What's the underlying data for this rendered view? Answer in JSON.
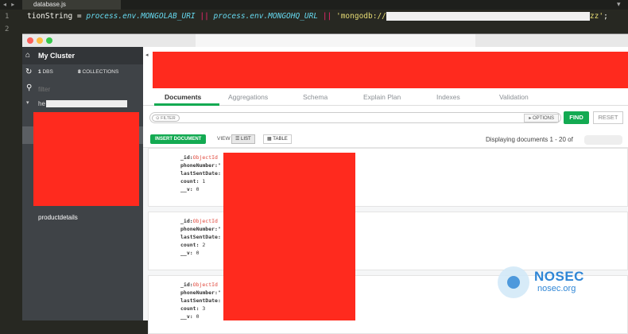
{
  "editor": {
    "tab_label": "database.js",
    "nav_arrows": "◂ ▸",
    "close_glyph": "▾",
    "line_numbers": [
      "1",
      "2"
    ],
    "code": {
      "part1": "tionString = ",
      "obj1": "process.env.MONGOLAB_URI",
      "op1": " || ",
      "obj2": "process.env.MONGOHQ_URL",
      "op2": " || ",
      "str1": "'mongodb://",
      "str2": "zz'",
      "end": ";"
    }
  },
  "sidebar": {
    "cluster_name": "My Cluster",
    "dbs_count": "1",
    "dbs_label": "DBS",
    "collections_count": "8",
    "collections_label": "COLLECTIONS",
    "filter_placeholder": "filter",
    "db_name_prefix": "he",
    "collection_item": "productdetails"
  },
  "tabs": [
    {
      "label": "Documents"
    },
    {
      "label": "Aggregations"
    },
    {
      "label": "Schema"
    },
    {
      "label": "Explain Plan"
    },
    {
      "label": "Indexes"
    },
    {
      "label": "Validation"
    }
  ],
  "query": {
    "filter_pill": "⊙ FILTER",
    "options": "▸ OPTIONS",
    "find": "FIND",
    "reset": "RESET"
  },
  "toolbar": {
    "insert": "INSERT DOCUMENT",
    "view": "VIEW",
    "list": "☰ LIST",
    "table": "▦ TABLE",
    "display": "Displaying documents 1 - 20 of"
  },
  "documents": [
    {
      "id_key": "_id:",
      "id_val": "ObjectId",
      "phone_key": "phoneNumber:",
      "phone_val": "\"",
      "date_key": "lastSentDate:",
      "count_key": "count:",
      "count_val": "1",
      "v_key": "__v:",
      "v_val": "0"
    },
    {
      "id_key": "_id:",
      "id_val": "ObjectId",
      "phone_key": "phoneNumber:",
      "phone_val": "\"",
      "date_key": "lastSentDate:",
      "count_key": "count:",
      "count_val": "2",
      "v_key": "__v:",
      "v_val": "0"
    },
    {
      "id_key": "_id:",
      "id_val": "ObjectId",
      "phone_key": "phoneNumber:",
      "phone_val": "\"",
      "date_key": "lastSentDate:",
      "count_key": "count:",
      "count_val": "3",
      "v_key": "__v:",
      "v_val": "0"
    }
  ],
  "watermark": {
    "title": "NOSEC",
    "subtitle": "nosec.org"
  },
  "colors": {
    "accent_green": "#13aa52",
    "redaction": "#ff2a1e",
    "sidebar_bg": "#3f4347",
    "watermark_blue": "#2f86d6"
  }
}
